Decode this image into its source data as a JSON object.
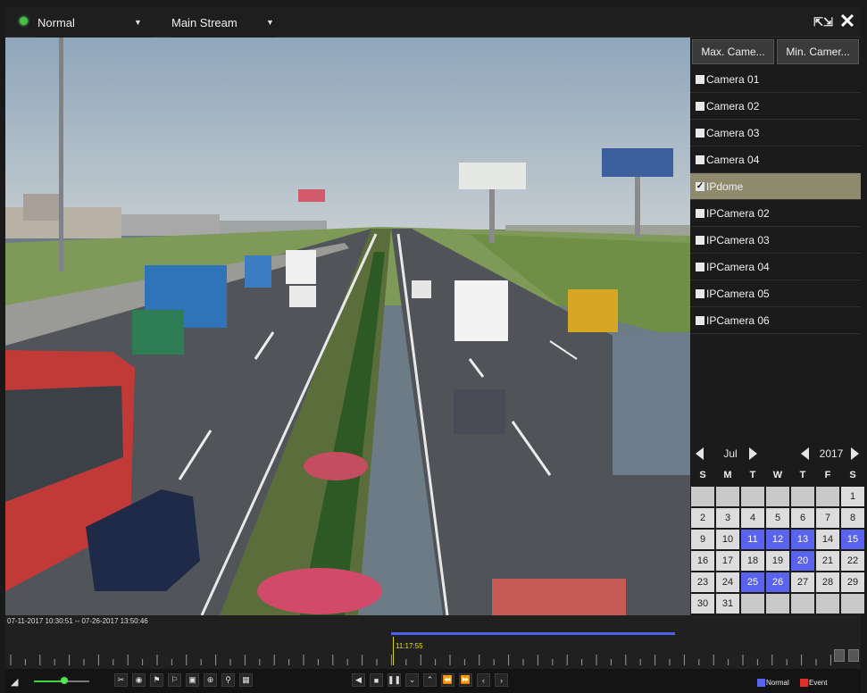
{
  "topbar": {
    "mode": "Normal",
    "stream": "Main Stream"
  },
  "panel": {
    "max_camera_label": "Max. Came...",
    "min_camera_label": "Min. Camer...",
    "cameras": [
      {
        "label": "Camera 01",
        "checked": false
      },
      {
        "label": "Camera 02",
        "checked": false
      },
      {
        "label": "Camera 03",
        "checked": false
      },
      {
        "label": "Camera 04",
        "checked": false
      },
      {
        "label": "IPdome",
        "checked": true
      },
      {
        "label": "IPCamera 02",
        "checked": false
      },
      {
        "label": "IPCamera 03",
        "checked": false
      },
      {
        "label": "IPCamera 04",
        "checked": false
      },
      {
        "label": "IPCamera 05",
        "checked": false
      },
      {
        "label": "IPCamera 06",
        "checked": false
      }
    ]
  },
  "calendar": {
    "month": "Jul",
    "year": "2017",
    "weekdays": [
      "S",
      "M",
      "T",
      "W",
      "T",
      "F",
      "S"
    ],
    "first_weekday_index": 6,
    "days_in_month": 31,
    "recorded_days": [
      11,
      12,
      13,
      15,
      20,
      25,
      26
    ],
    "record_color": "#5a62f0"
  },
  "timeline": {
    "range_text": "07-11-2017 10:30:51 -- 07-26-2017 13:50:46",
    "cursor_time": "11:17:55",
    "record_color": "#4a62f2"
  },
  "toolbar": {
    "volume_level": 0.55,
    "legend": [
      {
        "label": "Normal",
        "color": "#5a62f0"
      },
      {
        "label": "Event",
        "color": "#e0302a"
      }
    ]
  }
}
